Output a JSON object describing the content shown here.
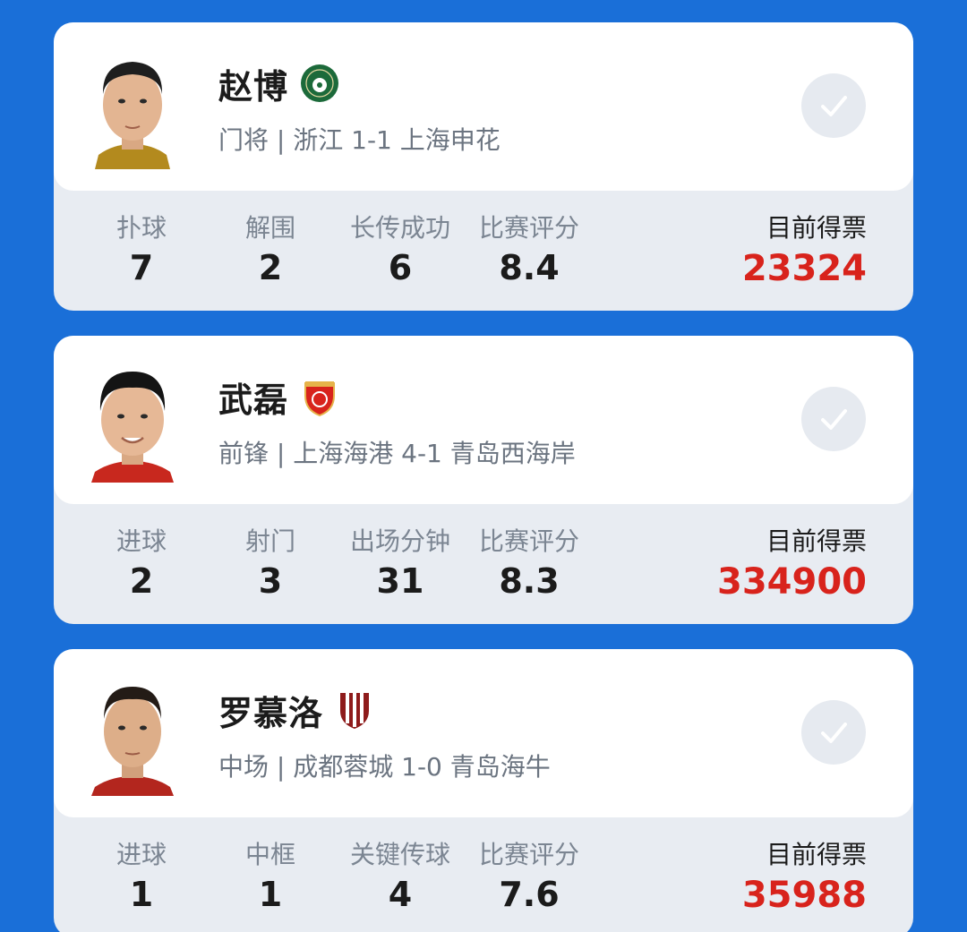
{
  "accent_color": "#1a6fd8",
  "vote_color": "#d8231c",
  "players": [
    {
      "name": "赵博",
      "info": "门将 | 浙江 1-1 上海申花",
      "team_badge": "zhejiang-badge-icon",
      "stats": [
        {
          "label": "扑球",
          "value": "7"
        },
        {
          "label": "解围",
          "value": "2"
        },
        {
          "label": "长传成功",
          "value": "6"
        },
        {
          "label": "比赛评分",
          "value": "8.4"
        }
      ],
      "votes_label": "目前得票",
      "votes": "23324"
    },
    {
      "name": "武磊",
      "info": "前锋 | 上海海港 4-1 青岛西海岸",
      "team_badge": "shanghai-port-badge-icon",
      "stats": [
        {
          "label": "进球",
          "value": "2"
        },
        {
          "label": "射门",
          "value": "3"
        },
        {
          "label": "出场分钟",
          "value": "31"
        },
        {
          "label": "比赛评分",
          "value": "8.3"
        }
      ],
      "votes_label": "目前得票",
      "votes": "334900"
    },
    {
      "name": "罗慕洛",
      "info": "中场 | 成都蓉城 1-0 青岛海牛",
      "team_badge": "chengdu-rongcheng-badge-icon",
      "stats": [
        {
          "label": "进球",
          "value": "1"
        },
        {
          "label": "中框",
          "value": "1"
        },
        {
          "label": "关键传球",
          "value": "4"
        },
        {
          "label": "比赛评分",
          "value": "7.6"
        }
      ],
      "votes_label": "目前得票",
      "votes": "35988"
    }
  ]
}
